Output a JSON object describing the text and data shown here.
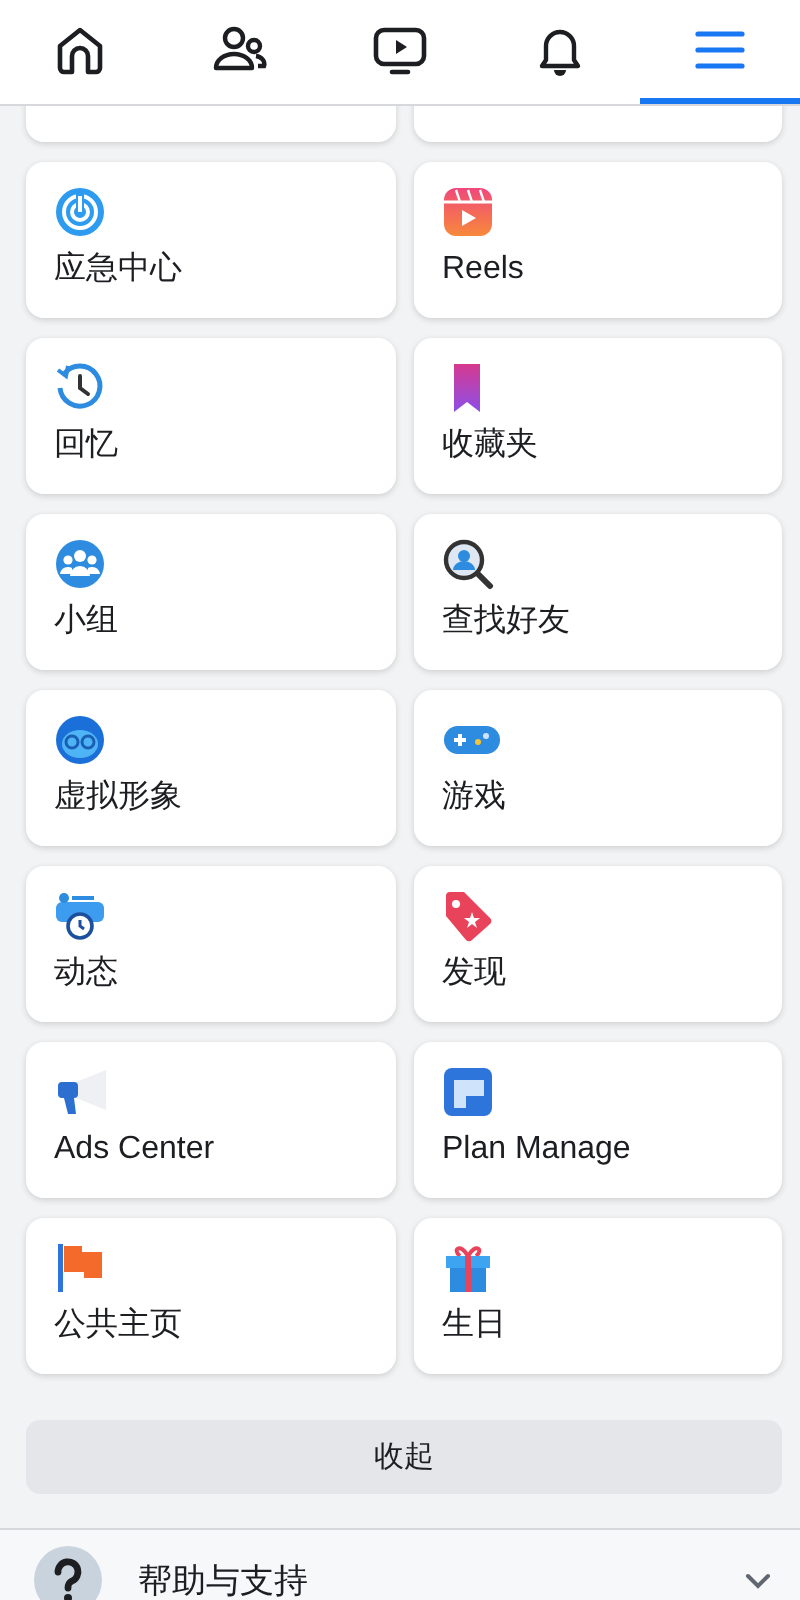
{
  "nav": {
    "tabs": [
      {
        "kind": "home",
        "selected": false
      },
      {
        "kind": "friends",
        "selected": false
      },
      {
        "kind": "video",
        "selected": false
      },
      {
        "kind": "bell",
        "selected": false
      },
      {
        "kind": "menu",
        "selected": true
      }
    ]
  },
  "shortcuts": [
    {
      "label": "应急中心",
      "kind": "crisis"
    },
    {
      "label": "Reels",
      "kind": "reels"
    },
    {
      "label": "回忆",
      "kind": "memories"
    },
    {
      "label": "收藏夹",
      "kind": "saved"
    },
    {
      "label": "小组",
      "kind": "groups"
    },
    {
      "label": "查找好友",
      "kind": "findfriends"
    },
    {
      "label": "虚拟形象",
      "kind": "avatar"
    },
    {
      "label": "游戏",
      "kind": "gaming"
    },
    {
      "label": "动态",
      "kind": "feeds"
    },
    {
      "label": "发现",
      "kind": "offers"
    },
    {
      "label": "Ads Center",
      "kind": "ads"
    },
    {
      "label": "Plan Manage",
      "kind": "plan"
    },
    {
      "label": "公共主页",
      "kind": "pages"
    },
    {
      "label": "生日",
      "kind": "birthday"
    }
  ],
  "collapse_button": "收起",
  "help_section": {
    "label": "帮助与支持",
    "expanded": false
  }
}
